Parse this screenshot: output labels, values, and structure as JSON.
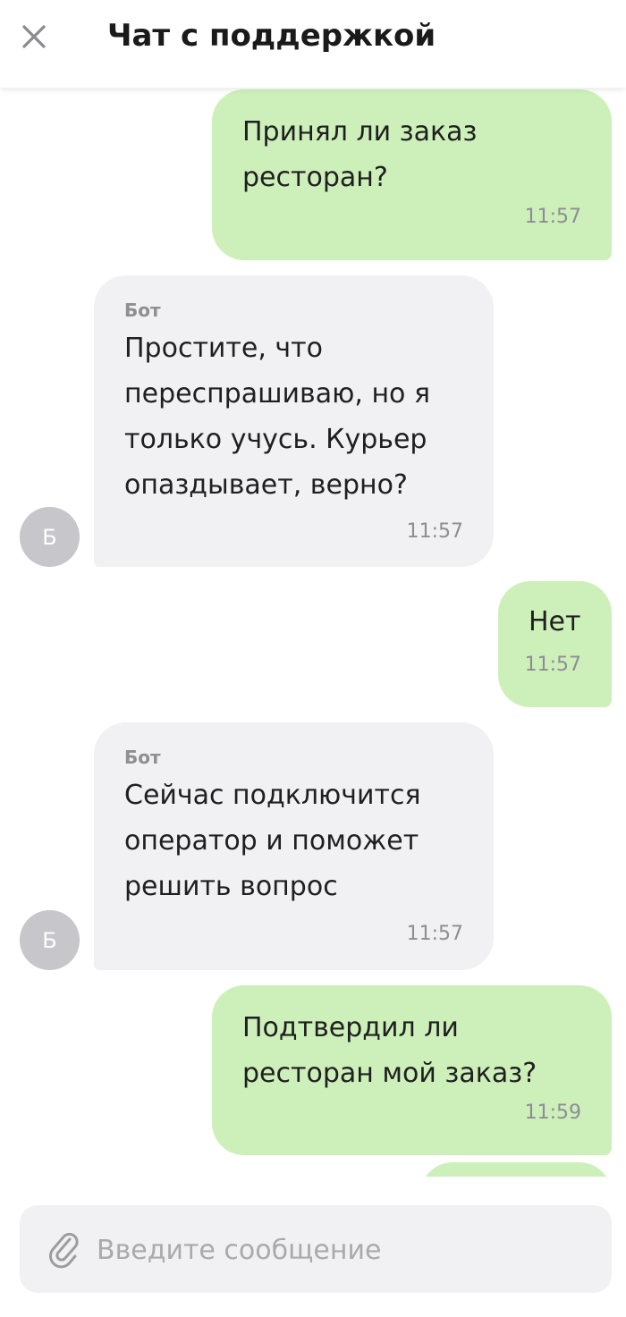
{
  "header": {
    "title": "Чат с поддержкой",
    "close_icon": "close-icon"
  },
  "messages": [
    {
      "direction": "outgoing",
      "text": "Принял ли заказ\nресторан?",
      "time": "11:57"
    },
    {
      "direction": "incoming",
      "sender": "Бот",
      "avatar": "Б",
      "text": "Простите, что\nпереспрашиваю, но я\nтолько учусь. Курьер\nопаздывает, верно?",
      "time": "11:57"
    },
    {
      "direction": "outgoing",
      "text": "Нет",
      "time": "11:57"
    },
    {
      "direction": "incoming",
      "sender": "Бот",
      "avatar": "Б",
      "text": "Сейчас подключится\nоператор и поможет\nрешить вопрос",
      "time": "11:57"
    },
    {
      "direction": "outgoing",
      "text": "Подтвердил ли\nресторан мой заказ?",
      "time": "11:59"
    }
  ],
  "composer": {
    "placeholder": "Введите сообщение",
    "value": "",
    "attach_icon": "paperclip-icon"
  },
  "colors": {
    "outgoing_bubble": "#cdf0ba",
    "incoming_bubble": "#f1f1f3",
    "avatar": "#c6c6cb",
    "timestamp": "#8d8d92"
  }
}
